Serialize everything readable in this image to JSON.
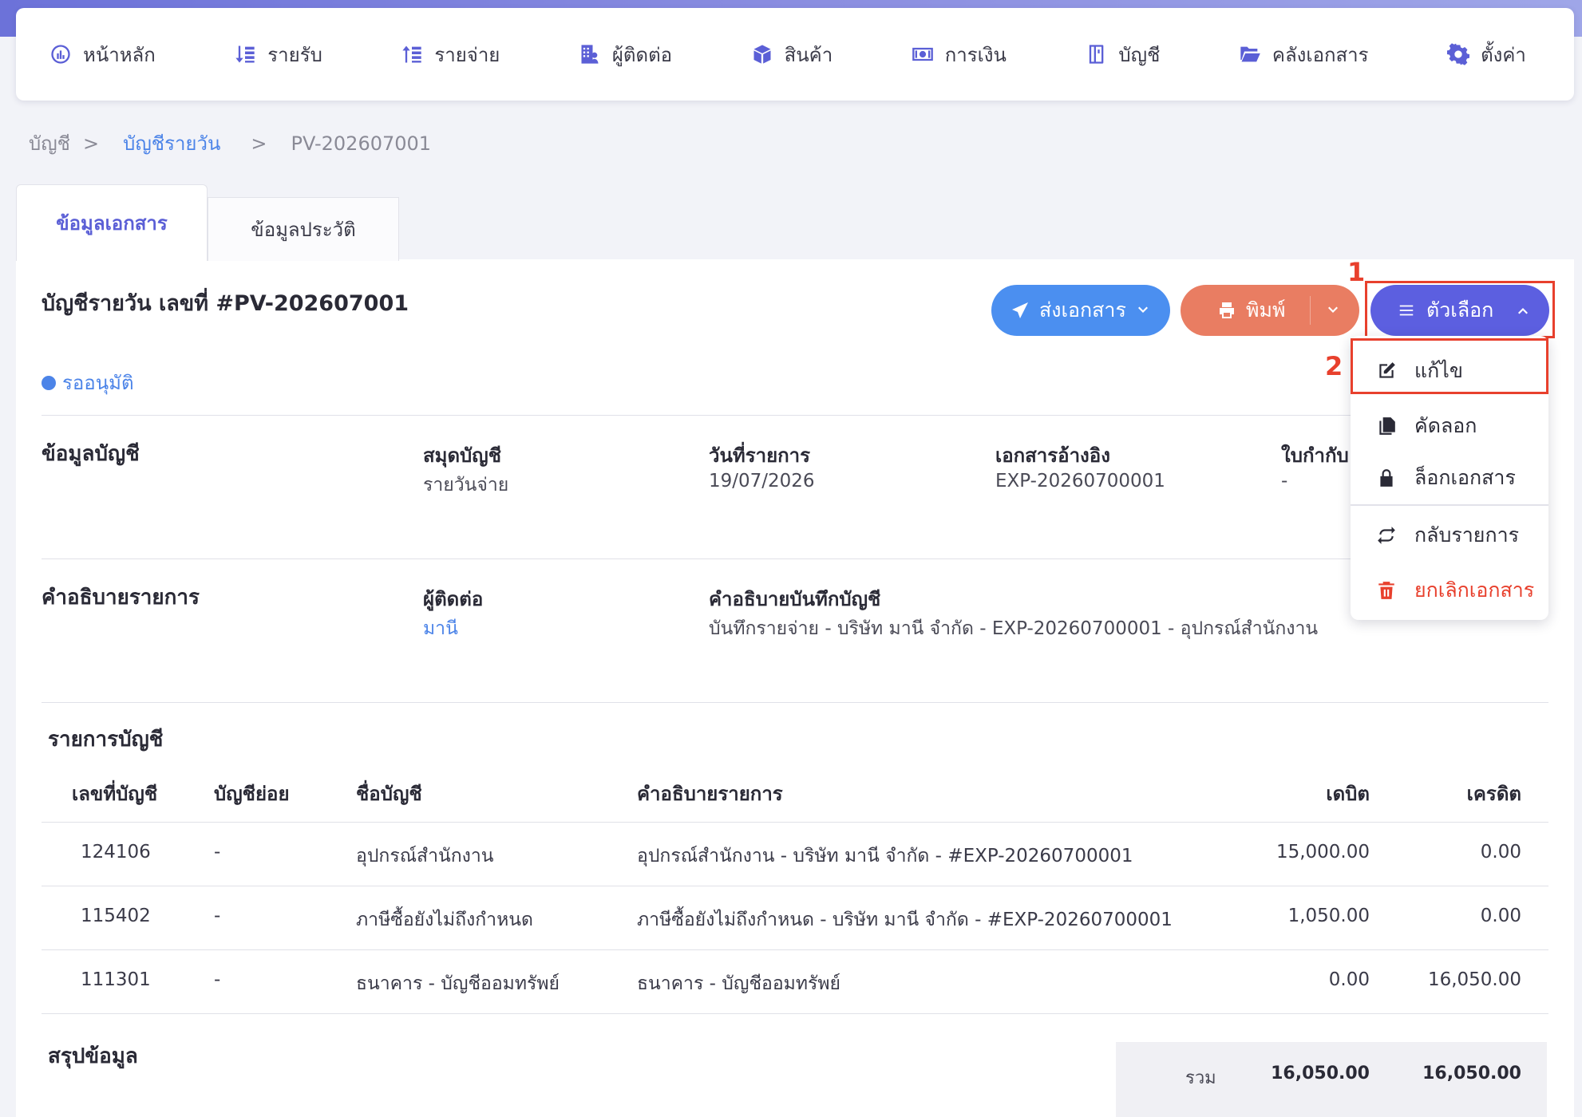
{
  "nav": {
    "items": [
      {
        "label": "หน้าหลัก",
        "icon": "dashboard-icon"
      },
      {
        "label": "รายรับ",
        "icon": "income-icon"
      },
      {
        "label": "รายจ่าย",
        "icon": "expense-icon"
      },
      {
        "label": "ผู้ติดต่อ",
        "icon": "contacts-icon"
      },
      {
        "label": "สินค้า",
        "icon": "product-box-icon"
      },
      {
        "label": "การเงิน",
        "icon": "money-icon"
      },
      {
        "label": "บัญชี",
        "icon": "ledger-book-icon"
      },
      {
        "label": "คลังเอกสาร",
        "icon": "folder-icon"
      },
      {
        "label": "ตั้งค่า",
        "icon": "gear-icon"
      }
    ]
  },
  "breadcrumb": {
    "root": "บัญชี",
    "sep": ">",
    "parent": "บัญชีรายวัน",
    "current": "PV-202607001"
  },
  "tabs": {
    "document": "ข้อมูลเอกสาร",
    "history": "ข้อมูลประวัติ"
  },
  "document": {
    "title": "บัญชีรายวัน เลขที่ #PV-202607001",
    "status": "รออนุมัติ",
    "status_color": "#4c84e8"
  },
  "actions": {
    "send": "ส่งเอกสาร",
    "print": "พิมพ์",
    "options": "ตัวเลือก",
    "send_color": "#4b8ff0",
    "print_color": "#e97d62",
    "options_color": "#5c5fe0"
  },
  "annotations": {
    "one": "1",
    "two": "2",
    "color": "#e8402d"
  },
  "options_menu": {
    "edit": "แก้ไข",
    "copy": "คัดลอก",
    "lock": "ล็อกเอกสาร",
    "revert": "กลับรายการ",
    "cancel": "ยกเลิกเอกสาร"
  },
  "account_info": {
    "heading": "ข้อมูลบัญชี",
    "journal_label": "สมุดบัญชี",
    "journal_value": "รายวันจ่าย",
    "date_label": "วันที่รายการ",
    "date_value": "19/07/2026",
    "ref_label": "เอกสารอ้างอิง",
    "ref_value": "EXP-20260700001",
    "tax_label": "ใบกำกับ",
    "tax_value": "-"
  },
  "description": {
    "heading": "คำอธิบายรายการ",
    "contact_label": "ผู้ติดต่อ",
    "contact_value": "มานี",
    "memo_label": "คำอธิบายบันทึกบัญชี",
    "memo_value": "บันทึกรายจ่าย - บริษัท มานี จำกัด - EXP-20260700001 - อุปกรณ์สำนักงาน"
  },
  "entries": {
    "heading": "รายการบัญชี",
    "columns": {
      "code": "เลขที่บัญชี",
      "sub": "บัญชีย่อย",
      "name": "ชื่อบัญชี",
      "desc": "คำอธิบายรายการ",
      "debit": "เดบิต",
      "credit": "เครดิต"
    },
    "rows": [
      {
        "code": "124106",
        "sub": "-",
        "name": "อุปกรณ์สำนักงาน",
        "desc": "อุปกรณ์สำนักงาน - บริษัท มานี จำกัด - #EXP-20260700001",
        "debit": "15,000.00",
        "credit": "0.00"
      },
      {
        "code": "115402",
        "sub": "-",
        "name": "ภาษีซื้อยังไม่ถึงกำหนด",
        "desc": "ภาษีซื้อยังไม่ถึงกำหนด - บริษัท มานี จำกัด - #EXP-20260700001",
        "debit": "1,050.00",
        "credit": "0.00"
      },
      {
        "code": "111301",
        "sub": "-",
        "name": "ธนาคาร - บัญชีออมทรัพย์",
        "desc": "ธนาคาร - บัญชีออมทรัพย์",
        "debit": "0.00",
        "credit": "16,050.00"
      }
    ]
  },
  "summary": {
    "heading": "สรุปข้อมูล",
    "total_label": "รวม",
    "total_debit": "16,050.00",
    "total_credit": "16,050.00"
  }
}
